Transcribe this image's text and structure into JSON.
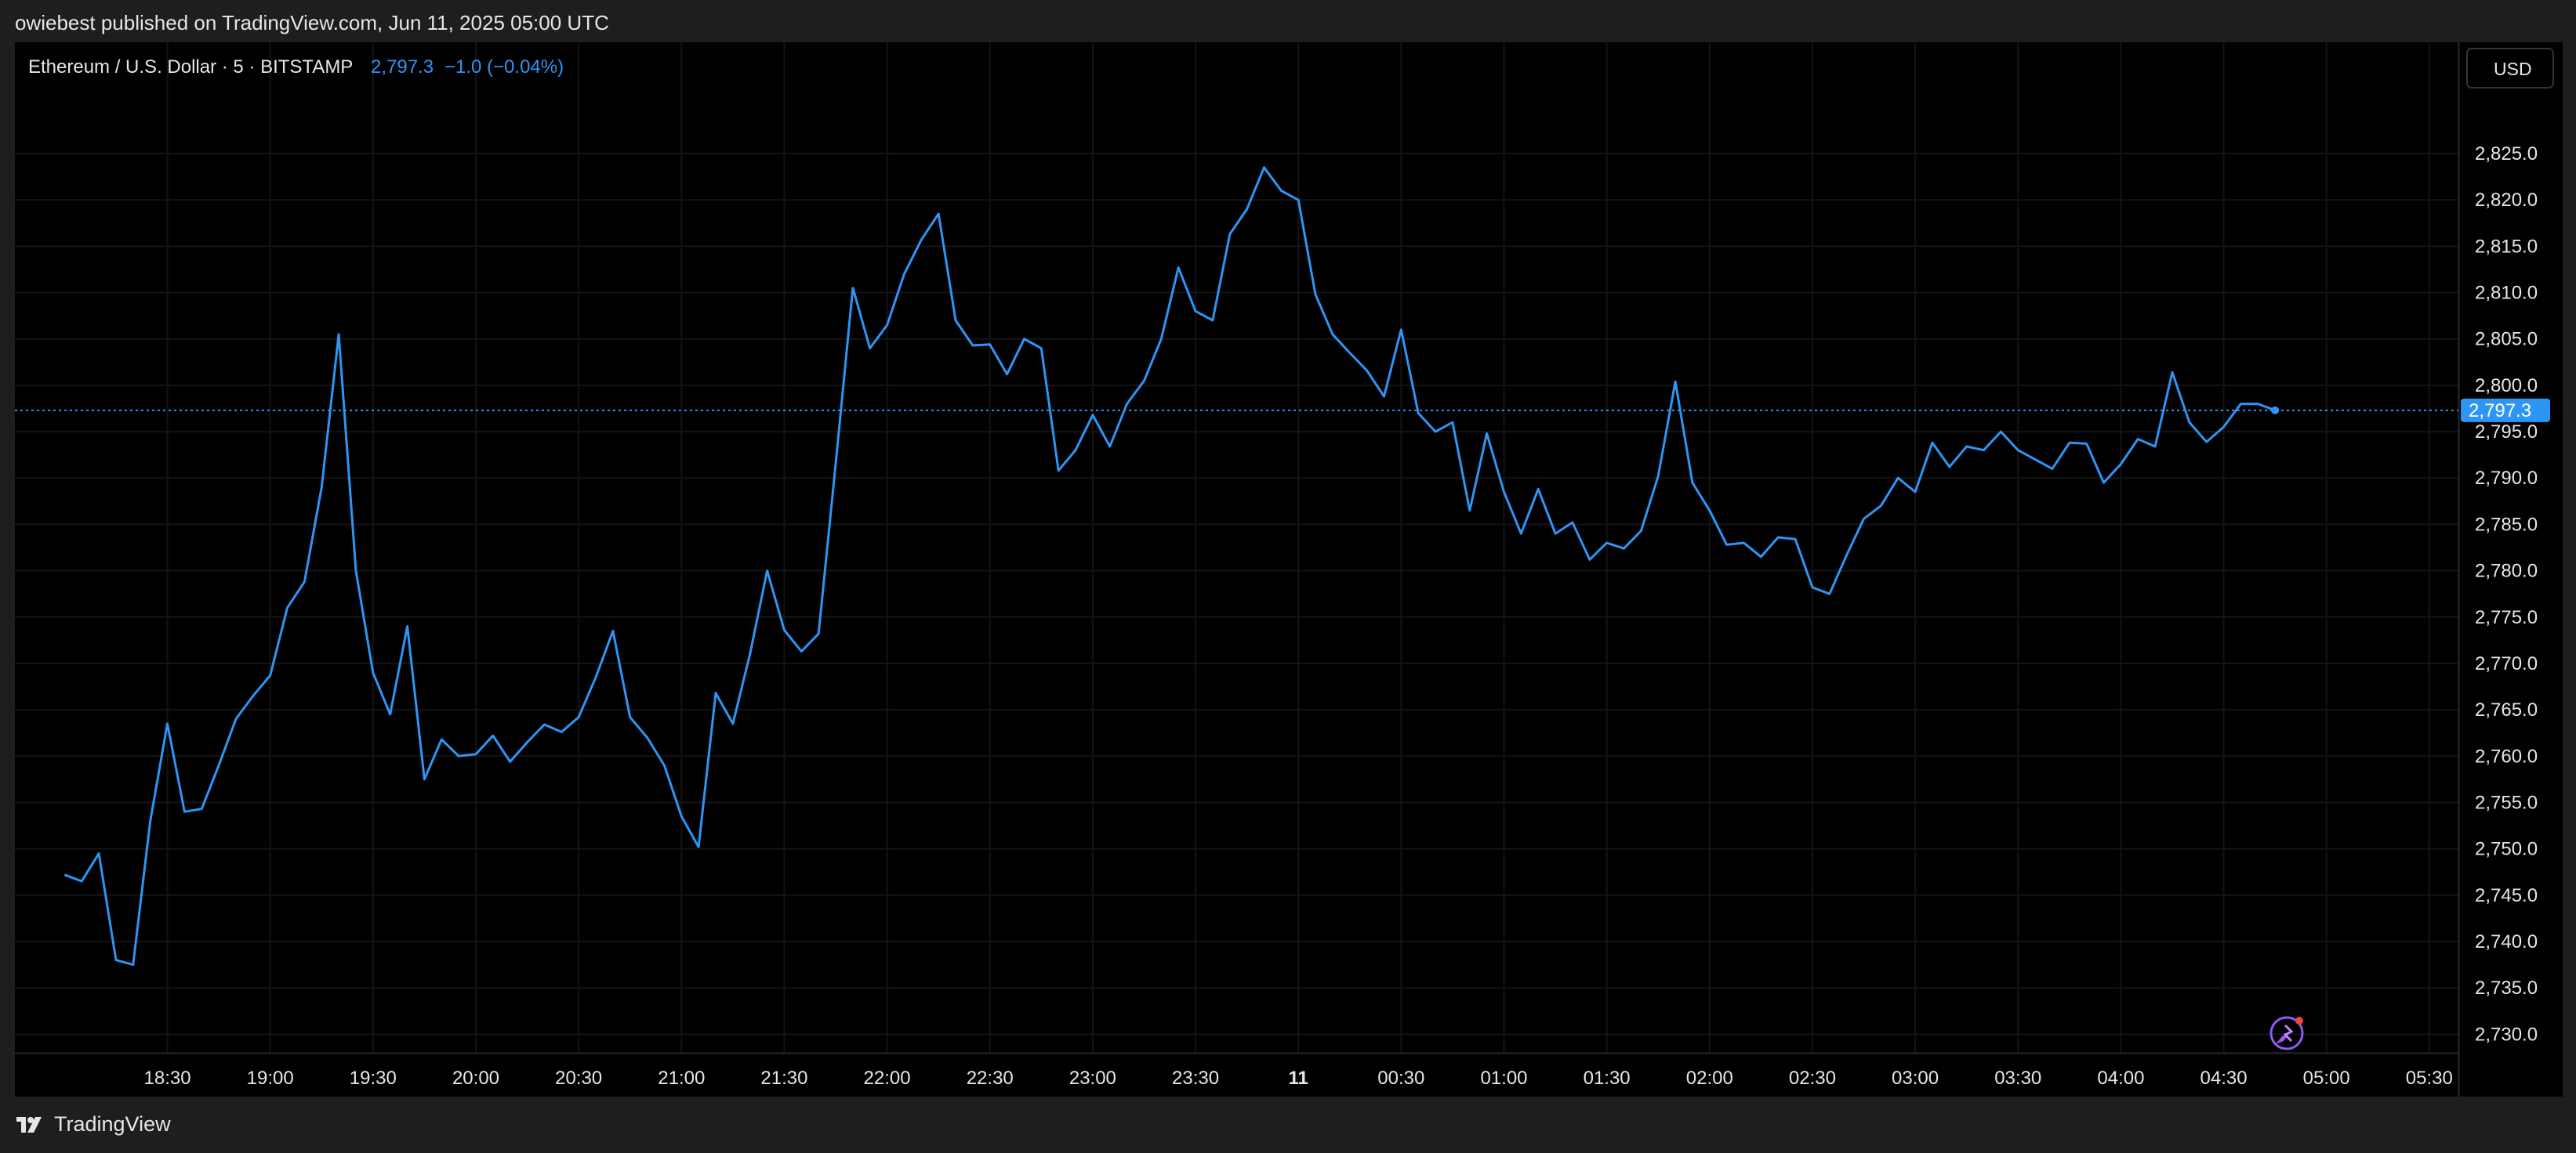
{
  "header": {
    "publisher_text": "owiebest published on TradingView.com, Jun 11, 2025 05:00 UTC"
  },
  "legend": {
    "symbol": "Ethereum / U.S. Dollar · 5 · BITSTAMP",
    "last": "2,797.3",
    "change": "−1.0 (−0.04%)"
  },
  "currency": "USD",
  "last_price_label": "2,797.3",
  "footer": {
    "brand": "TradingView"
  },
  "colors": {
    "line": "#2d95f5",
    "background": "#000000",
    "grid": "#141414",
    "text": "#e6e6e6",
    "price_label_bg": "#2d95f5"
  },
  "chart_data": {
    "type": "line",
    "title": "Ethereum / U.S. Dollar · 5 · BITSTAMP",
    "ylim": [
      2728,
      2837
    ],
    "y_ticks": [
      2730,
      2735,
      2740,
      2745,
      2750,
      2755,
      2760,
      2765,
      2770,
      2775,
      2780,
      2785,
      2790,
      2795,
      2800,
      2805,
      2810,
      2815,
      2820,
      2825
    ],
    "y_tick_labels": [
      "2,730.0",
      "2,735.0",
      "2,740.0",
      "2,745.0",
      "2,750.0",
      "2,755.0",
      "2,760.0",
      "2,765.0",
      "2,770.0",
      "2,775.0",
      "2,780.0",
      "2,785.0",
      "2,790.0",
      "2,795.0",
      "2,800.0",
      "2,805.0",
      "2,810.0",
      "2,815.0",
      "2,820.0",
      "2,825.0"
    ],
    "x_ticks": [
      {
        "t": 6,
        "label": "18:30",
        "bold": false
      },
      {
        "t": 12,
        "label": "19:00",
        "bold": false
      },
      {
        "t": 18,
        "label": "19:30",
        "bold": false
      },
      {
        "t": 24,
        "label": "20:00",
        "bold": false
      },
      {
        "t": 30,
        "label": "20:30",
        "bold": false
      },
      {
        "t": 36,
        "label": "21:00",
        "bold": false
      },
      {
        "t": 42,
        "label": "21:30",
        "bold": false
      },
      {
        "t": 48,
        "label": "22:00",
        "bold": false
      },
      {
        "t": 54,
        "label": "22:30",
        "bold": false
      },
      {
        "t": 60,
        "label": "23:00",
        "bold": false
      },
      {
        "t": 66,
        "label": "23:30",
        "bold": false
      },
      {
        "t": 72,
        "label": "11",
        "bold": true
      },
      {
        "t": 78,
        "label": "00:30",
        "bold": false
      },
      {
        "t": 84,
        "label": "01:00",
        "bold": false
      },
      {
        "t": 90,
        "label": "01:30",
        "bold": false
      },
      {
        "t": 96,
        "label": "02:00",
        "bold": false
      },
      {
        "t": 102,
        "label": "02:30",
        "bold": false
      },
      {
        "t": 108,
        "label": "03:00",
        "bold": false
      },
      {
        "t": 114,
        "label": "03:30",
        "bold": false
      },
      {
        "t": 120,
        "label": "04:00",
        "bold": false
      },
      {
        "t": 126,
        "label": "04:30",
        "bold": false
      },
      {
        "t": 132,
        "label": "05:00",
        "bold": false
      },
      {
        "t": 138,
        "label": "05:30",
        "bold": false
      }
    ],
    "x_range": [
      -2.9,
      139.7
    ],
    "series": [
      {
        "values": [
          2747.2,
          2746.5,
          2749.5,
          2738.0,
          2737.5,
          2753.0,
          2763.5,
          2754.0,
          2754.3,
          2759.0,
          2764.0,
          2766.5,
          2768.7,
          2776.0,
          2778.8,
          2789.0,
          2805.5,
          2780.0,
          2769.0,
          2764.5,
          2774.0,
          2757.5,
          2761.8,
          2760.0,
          2760.2,
          2762.2,
          2759.4,
          2761.5,
          2763.4,
          2762.6,
          2764.2,
          2768.5,
          2773.5,
          2764.2,
          2762.0,
          2759.0,
          2753.5,
          2750.2,
          2766.8,
          2763.5,
          2771.0,
          2780.0,
          2773.6,
          2771.3,
          2773.2,
          2791.5,
          2810.5,
          2804.0,
          2806.5,
          2812.0,
          2815.7,
          2818.5,
          2807.0,
          2804.3,
          2804.4,
          2801.2,
          2805.0,
          2804.0,
          2790.8,
          2793.0,
          2796.8,
          2793.4,
          2798.0,
          2800.5,
          2805.0,
          2812.7,
          2808.0,
          2807.0,
          2816.3,
          2819.0,
          2823.5,
          2821.0,
          2820.0,
          2809.8,
          2805.5,
          2803.5,
          2801.6,
          2798.8,
          2806.0,
          2797.0,
          2795.0,
          2796.0,
          2786.5,
          2794.8,
          2788.5,
          2784.0,
          2788.8,
          2784.0,
          2785.2,
          2781.2,
          2783.0,
          2782.4,
          2784.3,
          2790.2,
          2800.4,
          2789.5,
          2786.5,
          2782.8,
          2783.0,
          2781.5,
          2783.6,
          2783.4,
          2778.2,
          2777.5,
          2781.7,
          2785.6,
          2787.0,
          2790.0,
          2788.5,
          2793.8,
          2791.2,
          2793.4,
          2793.0,
          2795.0,
          2793.0,
          2792.0,
          2791.0,
          2793.8,
          2793.7,
          2789.5,
          2791.5,
          2794.2,
          2793.4,
          2801.4,
          2796.0,
          2793.9,
          2795.5,
          2798.0,
          2798.0,
          2797.3
        ]
      }
    ]
  }
}
